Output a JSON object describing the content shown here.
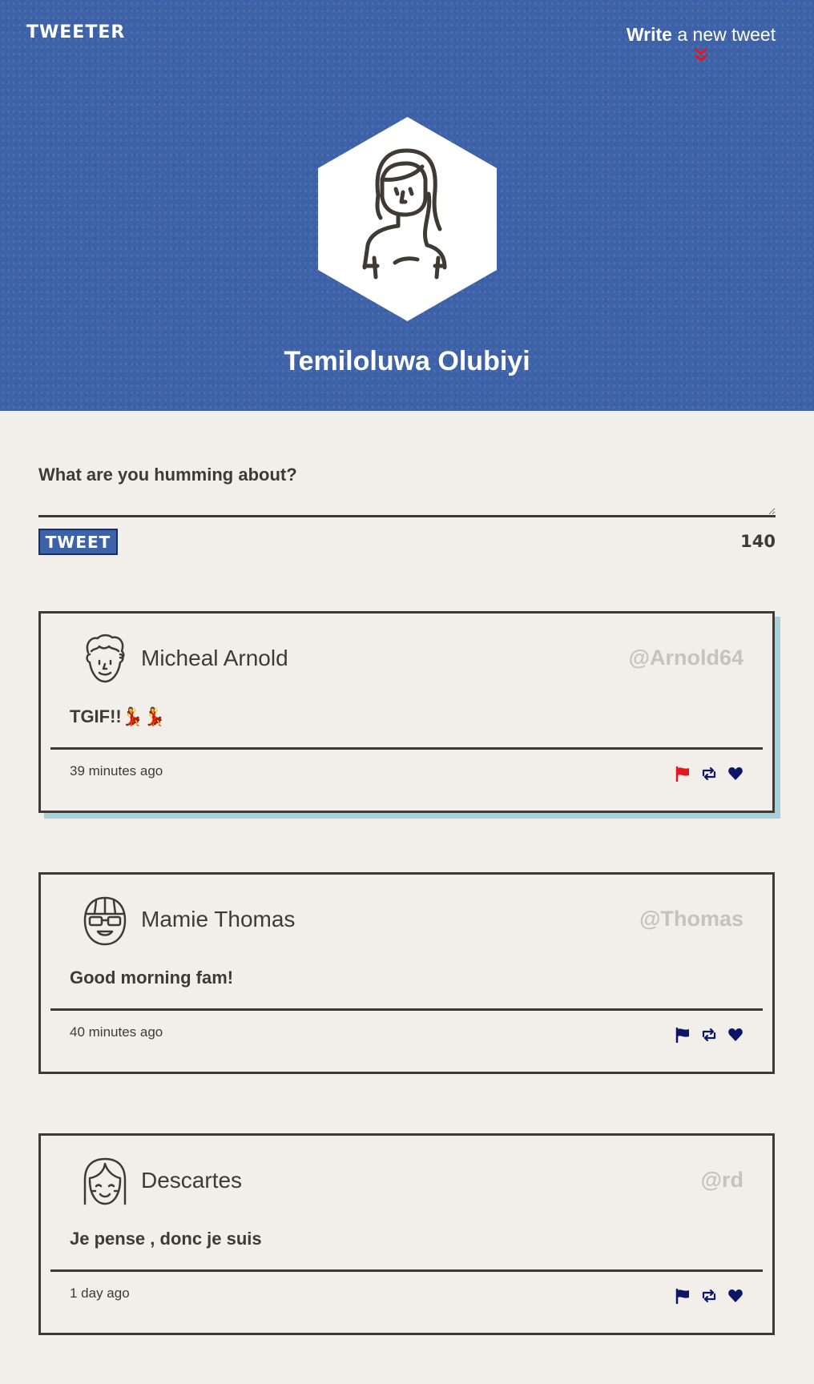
{
  "nav": {
    "logo": "TWEETER",
    "write_strong": "Write",
    "write_rest": " a new tweet"
  },
  "profile": {
    "name": "Temiloluwa Olubiyi"
  },
  "compose": {
    "placeholder": "What are you humming about?",
    "button_label": "TWEET",
    "counter": "140"
  },
  "tweets": [
    {
      "name": "Micheal Arnold",
      "handle": "@Arnold64",
      "text": "TGIF!!💃💃",
      "time": "39 minutes ago",
      "flag_color": "#e8141e"
    },
    {
      "name": "Mamie Thomas",
      "handle": "@Thomas",
      "text": "Good morning fam!",
      "time": "40 minutes ago",
      "flag_color": "#0b1666"
    },
    {
      "name": "Descartes",
      "handle": "@rd",
      "text": "Je pense , donc je suis",
      "time": "1 day ago",
      "flag_color": "#0b1666"
    }
  ],
  "colors": {
    "header_bg": "#3d62a8",
    "page_bg": "#f2efeb",
    "ink": "#403a35",
    "handle": "#c6c2bc",
    "accent_shadow": "#a4d3dd",
    "action_icon": "#0b1666",
    "arrow_red": "#e8141e"
  }
}
